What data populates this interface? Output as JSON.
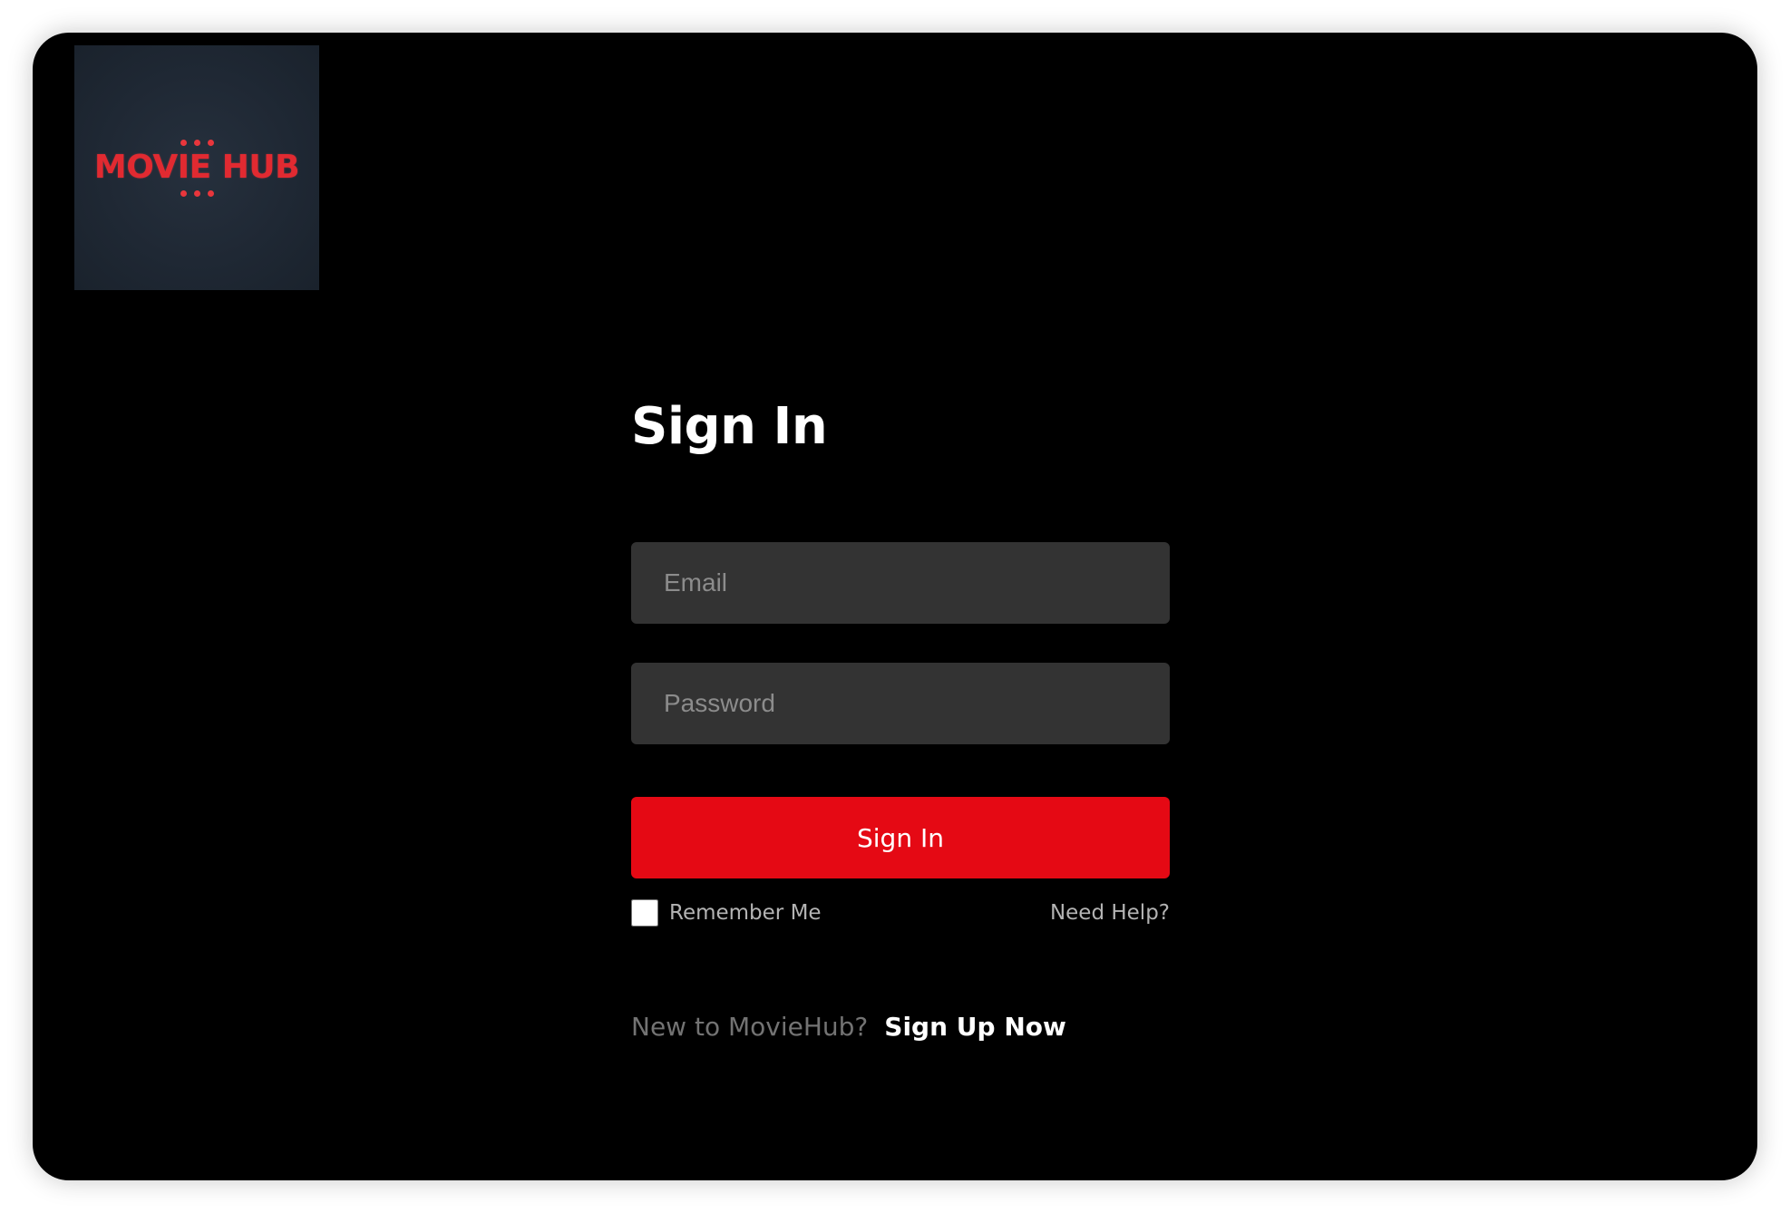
{
  "brand": {
    "logo_text": "MOVIE HUB",
    "accent_color": "#e50914"
  },
  "signin": {
    "title": "Sign In",
    "email_placeholder": "Email",
    "password_placeholder": "Password",
    "submit_label": "Sign In",
    "remember_label": "Remember Me",
    "remember_checked": false,
    "help_label": "Need Help?"
  },
  "signup": {
    "prompt": "New to MovieHub?",
    "link_label": "Sign Up Now"
  },
  "colors": {
    "background": "#000000",
    "input_background": "#333333",
    "button": "#e50914"
  }
}
